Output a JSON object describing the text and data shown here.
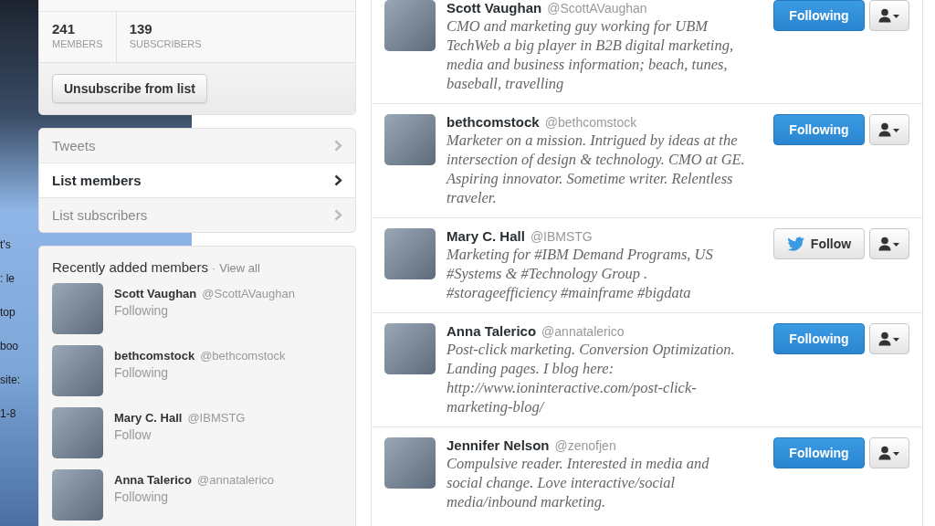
{
  "background_text": [
    "t's",
    ": le",
    "top",
    "boo",
    "site:",
    "1-8"
  ],
  "list_stats": [
    {
      "value": "241",
      "label": "MEMBERS"
    },
    {
      "value": "139",
      "label": "SUBSCRIBERS"
    }
  ],
  "unsubscribe_button": "Unsubscribe from list",
  "nav": [
    {
      "label": "Tweets",
      "selected": false
    },
    {
      "label": "List members",
      "selected": true
    },
    {
      "label": "List subscribers",
      "selected": false
    }
  ],
  "recent": {
    "title": "Recently added members",
    "separator": "·",
    "view_all": "View all",
    "members": [
      {
        "name": "Scott Vaughan",
        "handle": "@ScottAVaughan",
        "status": "Following"
      },
      {
        "name": "bethcomstock",
        "handle": "@bethcomstock",
        "status": "Following"
      },
      {
        "name": "Mary C. Hall",
        "handle": "@IBMSTG",
        "status": "Follow"
      },
      {
        "name": "Anna Talerico",
        "handle": "@annatalerico",
        "status": "Following"
      }
    ]
  },
  "members": [
    {
      "name": "Scott Vaughan",
      "handle": "@ScottAVaughan",
      "bio": "CMO and marketing guy working for UBM TechWeb a big player in B2B digital marketing, media and business information; beach, tunes, baseball, travelling",
      "button": {
        "kind": "following",
        "label": "Following"
      }
    },
    {
      "name": "bethcomstock",
      "handle": "@bethcomstock",
      "bio": "Marketer on a mission. Intrigued by ideas at the intersection of design & technology. CMO at GE. Aspiring innovator. Sometime writer. Relentless traveler.",
      "button": {
        "kind": "following",
        "label": "Following"
      }
    },
    {
      "name": "Mary C. Hall",
      "handle": "@IBMSTG",
      "bio": "Marketing for #IBM Demand Programs, US #Systems & #Technology Group . #storageefficiency #mainframe #bigdata",
      "button": {
        "kind": "follow",
        "label": "Follow"
      }
    },
    {
      "name": "Anna Talerico",
      "handle": "@annatalerico",
      "bio": "Post-click marketing. Conversion Optimization. Landing pages. I blog here: http://www.ioninteractive.com/post-click-marketing-blog/",
      "button": {
        "kind": "following",
        "label": "Following"
      }
    },
    {
      "name": "Jennifer Nelson",
      "handle": "@zenofjen",
      "bio": "Compulsive reader. Interested in media and social change. Love interactive/social media/inbound marketing.",
      "button": {
        "kind": "following",
        "label": "Following"
      }
    }
  ]
}
